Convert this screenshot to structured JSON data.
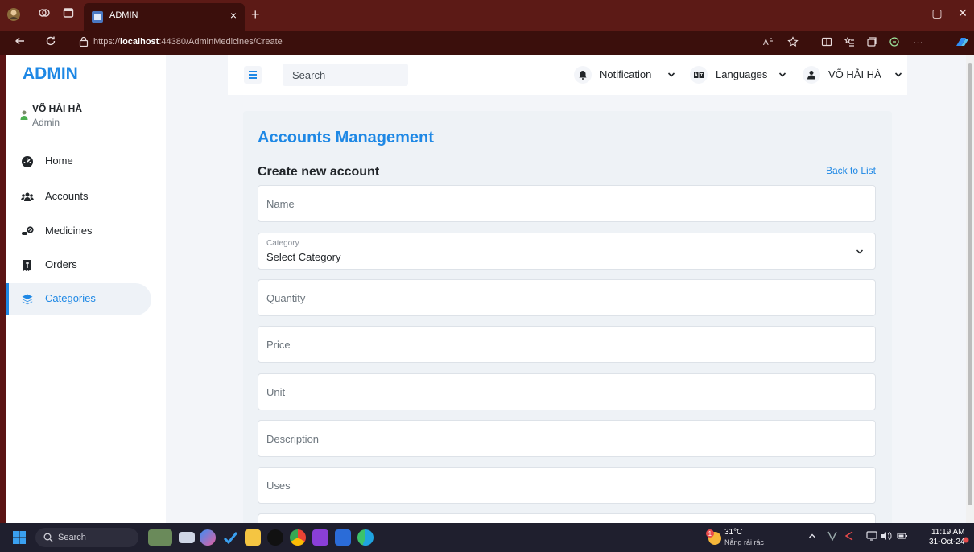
{
  "browser": {
    "tab_title": "ADMIN",
    "tab_close": "×",
    "new_tab": "+",
    "url_prefix": "https://",
    "url_host": "localhost",
    "url_rest": ":44380/AdminMedicines/Create",
    "minimize": "—",
    "restore": "▢",
    "close": "✕",
    "more": "···"
  },
  "sidebar": {
    "brand": "ADMIN",
    "user_name": "VÕ HẢI HÀ",
    "user_role": "Admin",
    "items": [
      {
        "label": "Home",
        "icon": "dashboard-icon"
      },
      {
        "label": "Accounts",
        "icon": "users-icon"
      },
      {
        "label": "Medicines",
        "icon": "pills-icon"
      },
      {
        "label": "Orders",
        "icon": "receipt-icon"
      },
      {
        "label": "Categories",
        "icon": "layers-icon",
        "active": true
      }
    ]
  },
  "header": {
    "search_placeholder": "Search",
    "notification": "Notification",
    "languages": "Languages",
    "user": "VÕ HẢI HÀ"
  },
  "card": {
    "title": "Accounts Management",
    "form_title": "Create new account",
    "back_link": "Back to List",
    "fields": {
      "name": "Name",
      "category_label": "Category",
      "category_value": "Select Category",
      "quantity": "Quantity",
      "price": "Price",
      "unit": "Unit",
      "description": "Description",
      "uses": "Uses"
    }
  },
  "taskbar": {
    "search": "Search",
    "temperature": "31°C",
    "condition": "Nắng rải rác",
    "weather_badge": "1",
    "time": "11:19 AM",
    "date": "31-Oct-24"
  },
  "colors": {
    "accent": "#1e88e5",
    "browser_frame": "#5c1a16",
    "content_bg": "#f3f5f9"
  }
}
